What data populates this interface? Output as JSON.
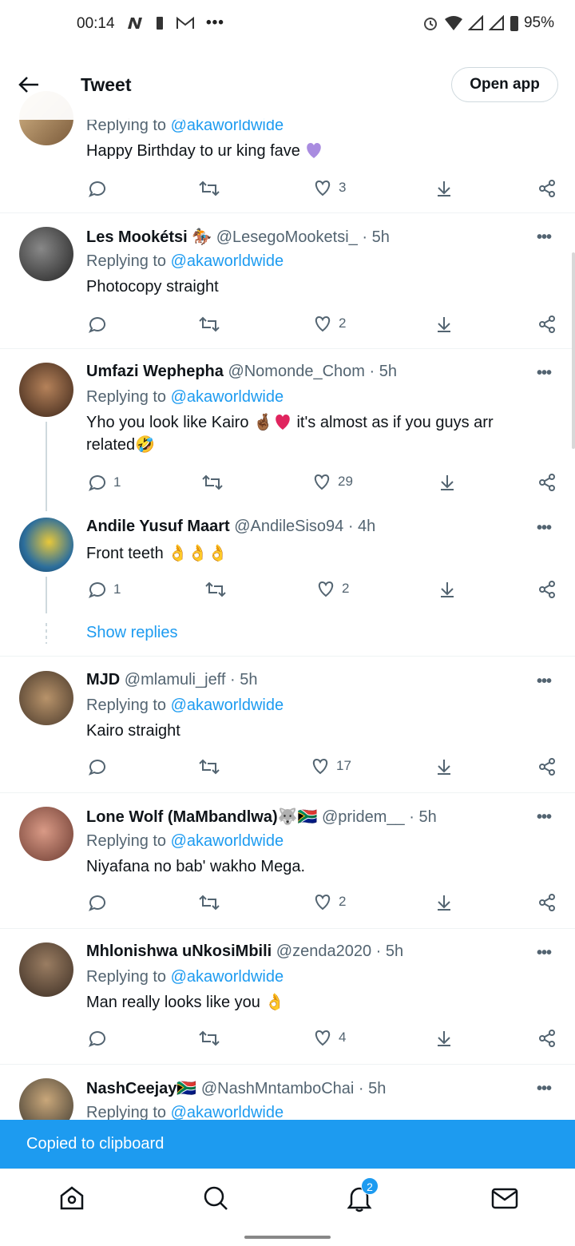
{
  "status_bar": {
    "time": "00:14",
    "battery": "95%"
  },
  "header": {
    "title": "Tweet",
    "open_app": "Open app"
  },
  "tweets": [
    {
      "replying_label": "Replying to",
      "replying_to": "@akaworldwide",
      "text": "Happy Birthday to ur king fave",
      "likes": "3"
    },
    {
      "name": "Les Mookétsi",
      "handle": "@LesegoMooketsi_ · 5h",
      "replying_label": "Replying to",
      "replying_to": "@akaworldwide",
      "text": "Photocopy straight",
      "likes": "2"
    },
    {
      "name": "Umfazi Wephepha",
      "handle": "@Nomonde_Chom · 5h",
      "replying_label": "Replying to",
      "replying_to": "@akaworldwide",
      "text_a": "Yho you look like Kairo",
      "text_b": "it's almost as if you guys arr",
      "text_c": "related",
      "replies": "1",
      "likes": "29"
    },
    {
      "name": "Andile Yusuf Maart",
      "handle": "@AndileSiso94 · 4h",
      "text": "Front teeth",
      "replies": "1",
      "likes": "2"
    },
    {
      "name": "MJD",
      "handle": "@mlamuli_jeff · 5h",
      "replying_label": "Replying to",
      "replying_to": "@akaworldwide",
      "text": "Kairo straight",
      "likes": "17"
    },
    {
      "name": "Lone Wolf (MaMbandlwa)",
      "handle": "@pridem__ · 5h",
      "replying_label": "Replying to",
      "replying_to": "@akaworldwide",
      "text": "Niyafana no bab' wakho Mega.",
      "likes": "2"
    },
    {
      "name": "Mhlonishwa uNkosiMbili",
      "handle": "@zenda2020 · 5h",
      "replying_label": "Replying to",
      "replying_to": "@akaworldwide",
      "text": "Man really looks like you",
      "likes": "4"
    },
    {
      "name": "NashCeejay",
      "handle": "@NashMntamboChai · 5h",
      "replying_label": "Replying to",
      "replying_to": "@akaworldwide"
    }
  ],
  "show_replies": "Show replies",
  "toast": "Copied to clipboard",
  "notifications_badge": "2",
  "colors": {
    "accent": "#1d9bf0",
    "text": "#0f1419",
    "muted": "#536471"
  },
  "icons": [
    "home-icon",
    "search-icon",
    "bell-icon",
    "mail-icon",
    "reply-icon",
    "retweet-icon",
    "like-icon",
    "share-down-icon",
    "share-icon",
    "more-icon"
  ]
}
